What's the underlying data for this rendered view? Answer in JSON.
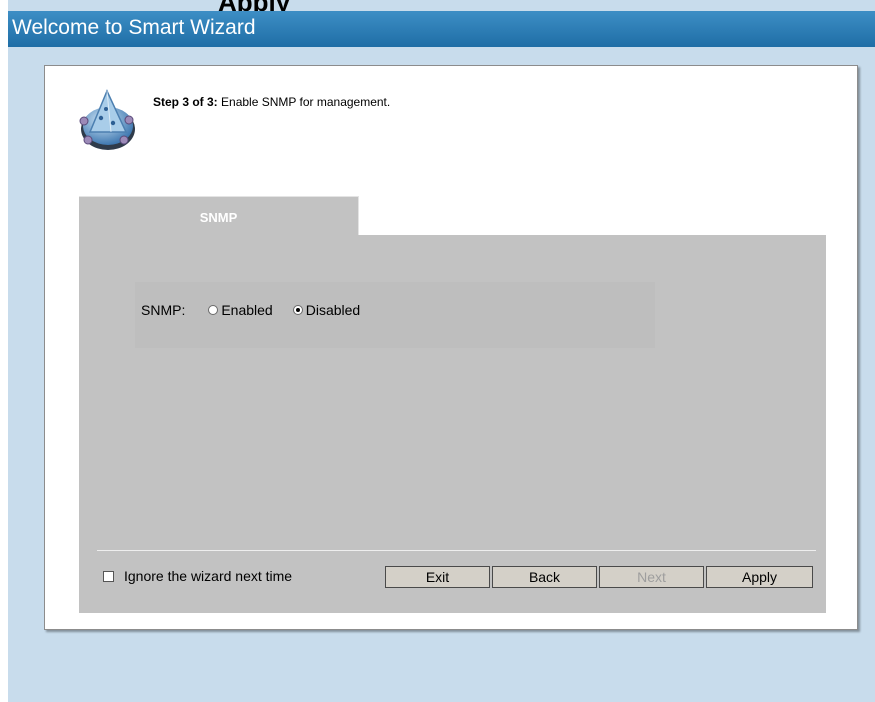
{
  "top_cut_text": "Apply",
  "window": {
    "title": "Welcome to Smart Wizard"
  },
  "wizard": {
    "step_label": "Step 3 of 3:",
    "step_description": " Enable SNMP for management."
  },
  "tab": {
    "label": "SNMP"
  },
  "snmp": {
    "label": "SNMP:",
    "options": [
      {
        "label": "Enabled",
        "selected": false
      },
      {
        "label": "Disabled",
        "selected": true
      }
    ]
  },
  "footer": {
    "ignore_label": "Ignore the wizard next time",
    "ignore_checked": false,
    "buttons": {
      "exit": "Exit",
      "back": "Back",
      "next": "Next",
      "apply": "Apply"
    },
    "next_enabled": false
  }
}
